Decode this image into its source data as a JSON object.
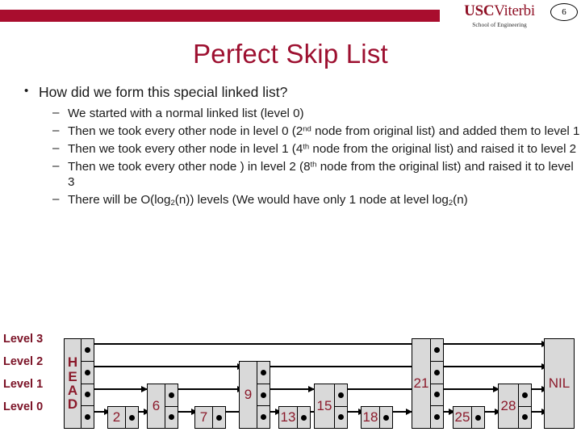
{
  "header": {
    "bar_color": "#a90d2e",
    "logo_usc": "USC",
    "logo_viterbi": "Viterbi",
    "logo_subtitle": "School of Engineering",
    "slide_number": "6"
  },
  "title": "Perfect Skip List",
  "bullets": {
    "main": "How did we form this special linked list?",
    "sub": [
      {
        "pre": "We started with a normal linked list (level 0)",
        "sup": "",
        "post": ""
      },
      {
        "pre": "Then we took every other node in level 0 (2",
        "sup": "nd",
        "post": " node from original list) and added them to level 1"
      },
      {
        "pre": "Then we took every other node in level 1 (4",
        "sup": "th",
        "post": " node from the original list) and raised it to level 2"
      },
      {
        "pre": "Then we took every other node ) in level 2 (8",
        "sup": "th",
        "post": " node from the original list) and raised it to level 3"
      }
    ],
    "last": {
      "p1": "There will be O(log",
      "s1": "2",
      "p2": "(n)) levels (We would have only 1 node at level log",
      "s2": "2",
      "p3": "(n)"
    }
  },
  "diagram": {
    "level_labels": [
      "Level 3",
      "Level 2",
      "Level 1",
      "Level 0"
    ],
    "head_letters": [
      "H",
      "E",
      "A",
      "D"
    ],
    "nil_label": "NIL",
    "nodes": [
      {
        "value": "HEAD",
        "height_levels": 4
      },
      {
        "value": "2",
        "height_levels": 1
      },
      {
        "value": "6",
        "height_levels": 2
      },
      {
        "value": "7",
        "height_levels": 1
      },
      {
        "value": "9",
        "height_levels": 3
      },
      {
        "value": "13",
        "height_levels": 1
      },
      {
        "value": "15",
        "height_levels": 2
      },
      {
        "value": "18",
        "height_levels": 1
      },
      {
        "value": "21",
        "height_levels": 4
      },
      {
        "value": "25",
        "height_levels": 1
      },
      {
        "value": "28",
        "height_levels": 2
      },
      {
        "value": "NIL",
        "height_levels": 4
      }
    ],
    "node_fill": "#d9d9d9",
    "value_color": "#8b1a2b",
    "label_color": "#7b1226"
  }
}
